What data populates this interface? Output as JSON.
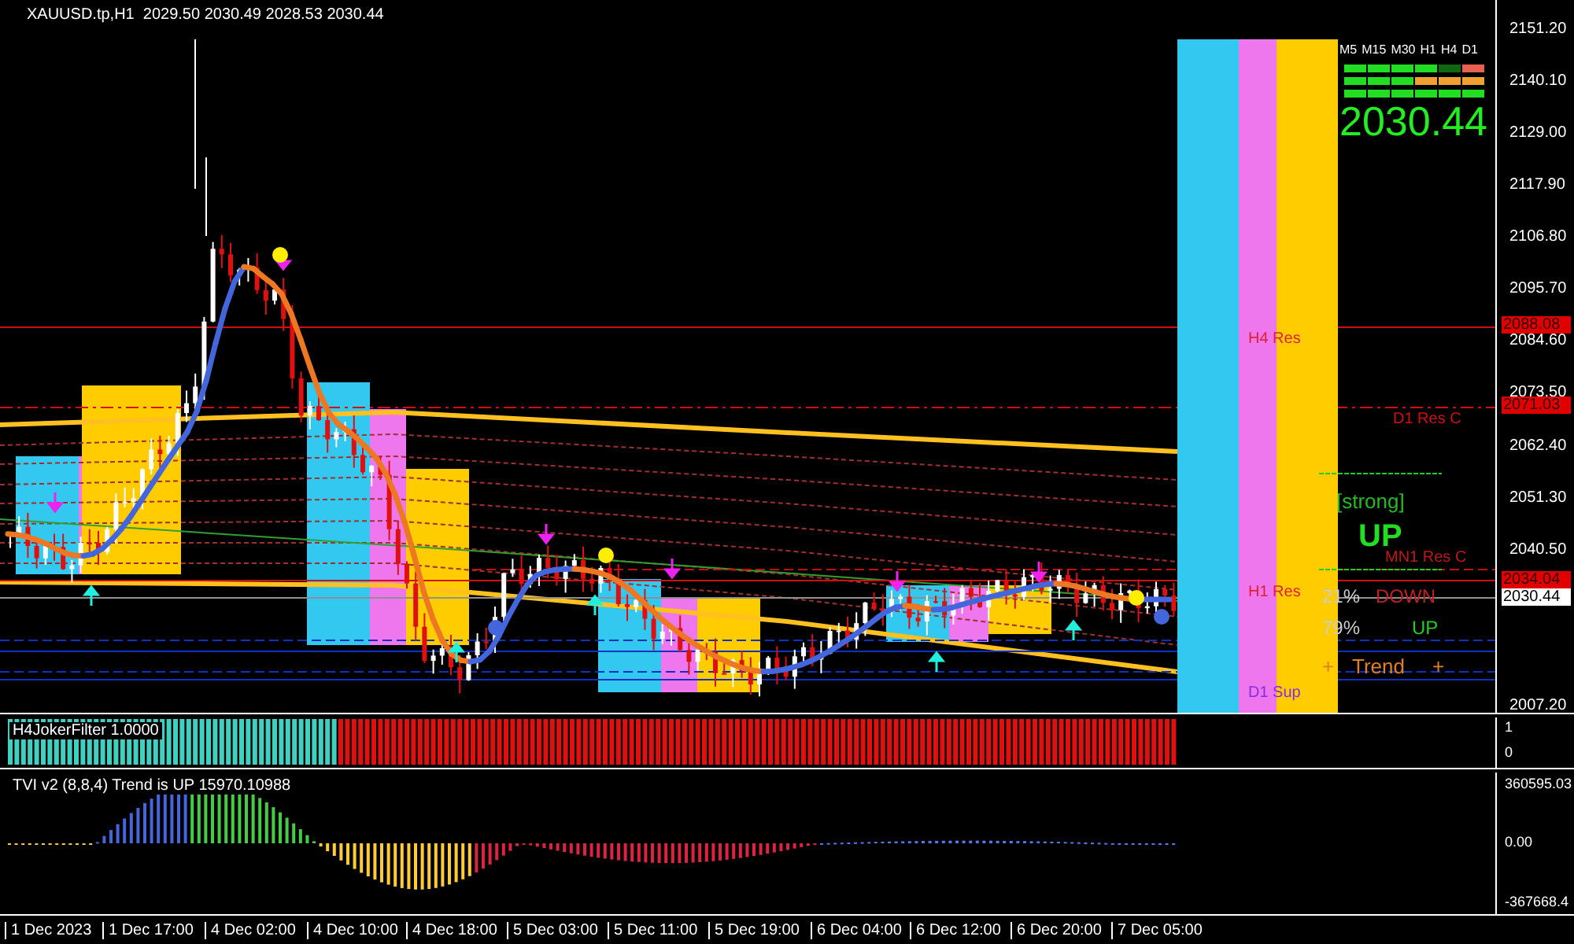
{
  "chart_title": "XAUUSD.tp,H1  2029.50 2030.49 2028.53 2030.44",
  "price_axis": [
    "2151.20",
    "2140.10",
    "2129.00",
    "2117.90",
    "2106.80",
    "2095.70",
    "2084.60",
    "2073.50",
    "2062.40",
    "2051.30",
    "2040.50",
    "2007.20"
  ],
  "price_tags": [
    {
      "text": "2088.08",
      "color": "#e00000"
    },
    {
      "text": "2071.03",
      "color": "#e00000"
    },
    {
      "text": "2034.04",
      "color": "#e00000"
    },
    {
      "text": "2030.44",
      "color": "#ffffff"
    }
  ],
  "level_labels": [
    {
      "text": "H4 Res",
      "color": "#e0203a"
    },
    {
      "text": "D1 Res C",
      "color": "#d01010"
    },
    {
      "text": "H1 Res",
      "color": "#e0203a"
    },
    {
      "text": "MN1 Res C",
      "color": "#c01818"
    },
    {
      "text": "D1 Sup",
      "color": "#8a2be2"
    }
  ],
  "trend_panel": {
    "timeframes": [
      "M5",
      "M15",
      "M30",
      "H1",
      "H4",
      "D1"
    ],
    "rows": [
      {
        "cells": [
          {
            "color": "#22dd22"
          },
          {
            "color": "#22dd22"
          },
          {
            "color": "#22dd22"
          },
          {
            "color": "#22dd22"
          },
          {
            "color": "#116611"
          },
          {
            "color": "#e86050"
          }
        ]
      },
      {
        "cells": [
          {
            "color": "#22dd22"
          },
          {
            "color": "#22dd22"
          },
          {
            "color": "#22dd22"
          },
          {
            "color": "#f0a030"
          },
          {
            "color": "#f0a030"
          },
          {
            "color": "#f0a030"
          }
        ]
      },
      {
        "cells": [
          {
            "color": "#22dd22"
          },
          {
            "color": "#22dd22"
          },
          {
            "color": "#22dd22"
          },
          {
            "color": "#22dd22"
          },
          {
            "color": "#22dd22"
          },
          {
            "color": "#22dd22"
          }
        ]
      }
    ],
    "price": "2030.44",
    "strength": "[strong]",
    "direction": "UP",
    "down_percent": "21%",
    "down_label": "DOWN",
    "up_percent": "79%",
    "up_label": "UP",
    "trend_label": "Trend",
    "trend_signs": [
      "+",
      "+"
    ]
  },
  "filter_indicator": {
    "title": "H4JokerFilter 1.0000",
    "axis": [
      "1",
      "0"
    ]
  },
  "tvi_indicator": {
    "title": "TVI v2 (8,8,4) Trend is UP 15970.10988",
    "axis": [
      "360595.03",
      "0.00",
      "-367668.4"
    ]
  },
  "time_axis": [
    "1 Dec 2023",
    "1 Dec 17:00",
    "4 Dec 02:00",
    "4 Dec 10:00",
    "4 Dec 18:00",
    "5 Dec 03:00",
    "5 Dec 11:00",
    "5 Dec 19:00",
    "6 Dec 04:00",
    "6 Dec 12:00",
    "6 Dec 20:00",
    "7 Dec 05:00"
  ]
}
